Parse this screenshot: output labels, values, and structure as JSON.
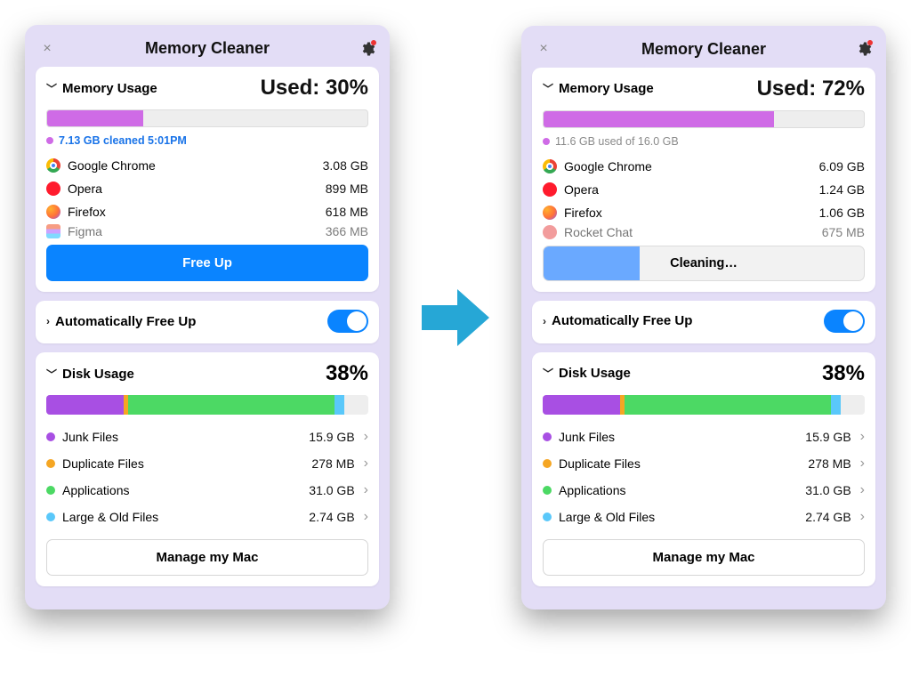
{
  "app": {
    "title": "Memory Cleaner"
  },
  "colors": {
    "brand_blue": "#0a84ff",
    "mem_fill": "#cf6be6",
    "arrow": "#26a7d6",
    "disk_purple": "#a84fe3",
    "disk_orange": "#f5a623",
    "disk_green": "#4cd964",
    "disk_blue": "#5ac8fa"
  },
  "left": {
    "memory": {
      "section_label": "Memory Usage",
      "used_prefix": "Used: ",
      "used_percent": 30,
      "status_text": "7.13 GB cleaned 5:01PM",
      "status_kind": "cleaned",
      "apps": [
        {
          "name": "Google Chrome",
          "size": "3.08 GB",
          "icon": "chrome"
        },
        {
          "name": "Opera",
          "size": "899 MB",
          "icon": "opera"
        },
        {
          "name": "Firefox",
          "size": "618 MB",
          "icon": "firefox"
        },
        {
          "name": "Figma",
          "size": "366 MB",
          "icon": "figma"
        }
      ],
      "button_label": "Free Up",
      "button_state": "idle"
    },
    "auto": {
      "label": "Automatically Free Up",
      "on": true
    },
    "disk": {
      "section_label": "Disk Usage",
      "percent": 38,
      "segments": [
        {
          "color": "purple",
          "pct": 24
        },
        {
          "color": "orange",
          "pct": 1.5
        },
        {
          "color": "green",
          "pct": 64
        },
        {
          "color": "blue",
          "pct": 3
        }
      ],
      "items": [
        {
          "name": "Junk Files",
          "size": "15.9 GB",
          "color": "purple"
        },
        {
          "name": "Duplicate Files",
          "size": "278 MB",
          "color": "orange"
        },
        {
          "name": "Applications",
          "size": "31.0 GB",
          "color": "green"
        },
        {
          "name": "Large & Old Files",
          "size": "2.74 GB",
          "color": "blue"
        }
      ],
      "button_label": "Manage my Mac"
    }
  },
  "right": {
    "memory": {
      "section_label": "Memory Usage",
      "used_prefix": "Used: ",
      "used_percent": 72,
      "status_text": "11.6 GB used of 16.0 GB",
      "status_kind": "used-of",
      "apps": [
        {
          "name": "Google Chrome",
          "size": "6.09 GB",
          "icon": "chrome"
        },
        {
          "name": "Opera",
          "size": "1.24 GB",
          "icon": "opera"
        },
        {
          "name": "Firefox",
          "size": "1.06 GB",
          "icon": "firefox"
        },
        {
          "name": "Rocket Chat",
          "size": "675 MB",
          "icon": "rocket"
        }
      ],
      "cleaning_label": "Cleaning…",
      "cleaning_progress_pct": 30,
      "button_state": "cleaning"
    },
    "auto": {
      "label": "Automatically Free Up",
      "on": true
    },
    "disk": {
      "section_label": "Disk Usage",
      "percent": 38,
      "segments": [
        {
          "color": "purple",
          "pct": 24
        },
        {
          "color": "orange",
          "pct": 1.5
        },
        {
          "color": "green",
          "pct": 64
        },
        {
          "color": "blue",
          "pct": 3
        }
      ],
      "items": [
        {
          "name": "Junk Files",
          "size": "15.9 GB",
          "color": "purple"
        },
        {
          "name": "Duplicate Files",
          "size": "278 MB",
          "color": "orange"
        },
        {
          "name": "Applications",
          "size": "31.0 GB",
          "color": "green"
        },
        {
          "name": "Large & Old Files",
          "size": "2.74 GB",
          "color": "blue"
        }
      ],
      "button_label": "Manage my Mac"
    }
  }
}
